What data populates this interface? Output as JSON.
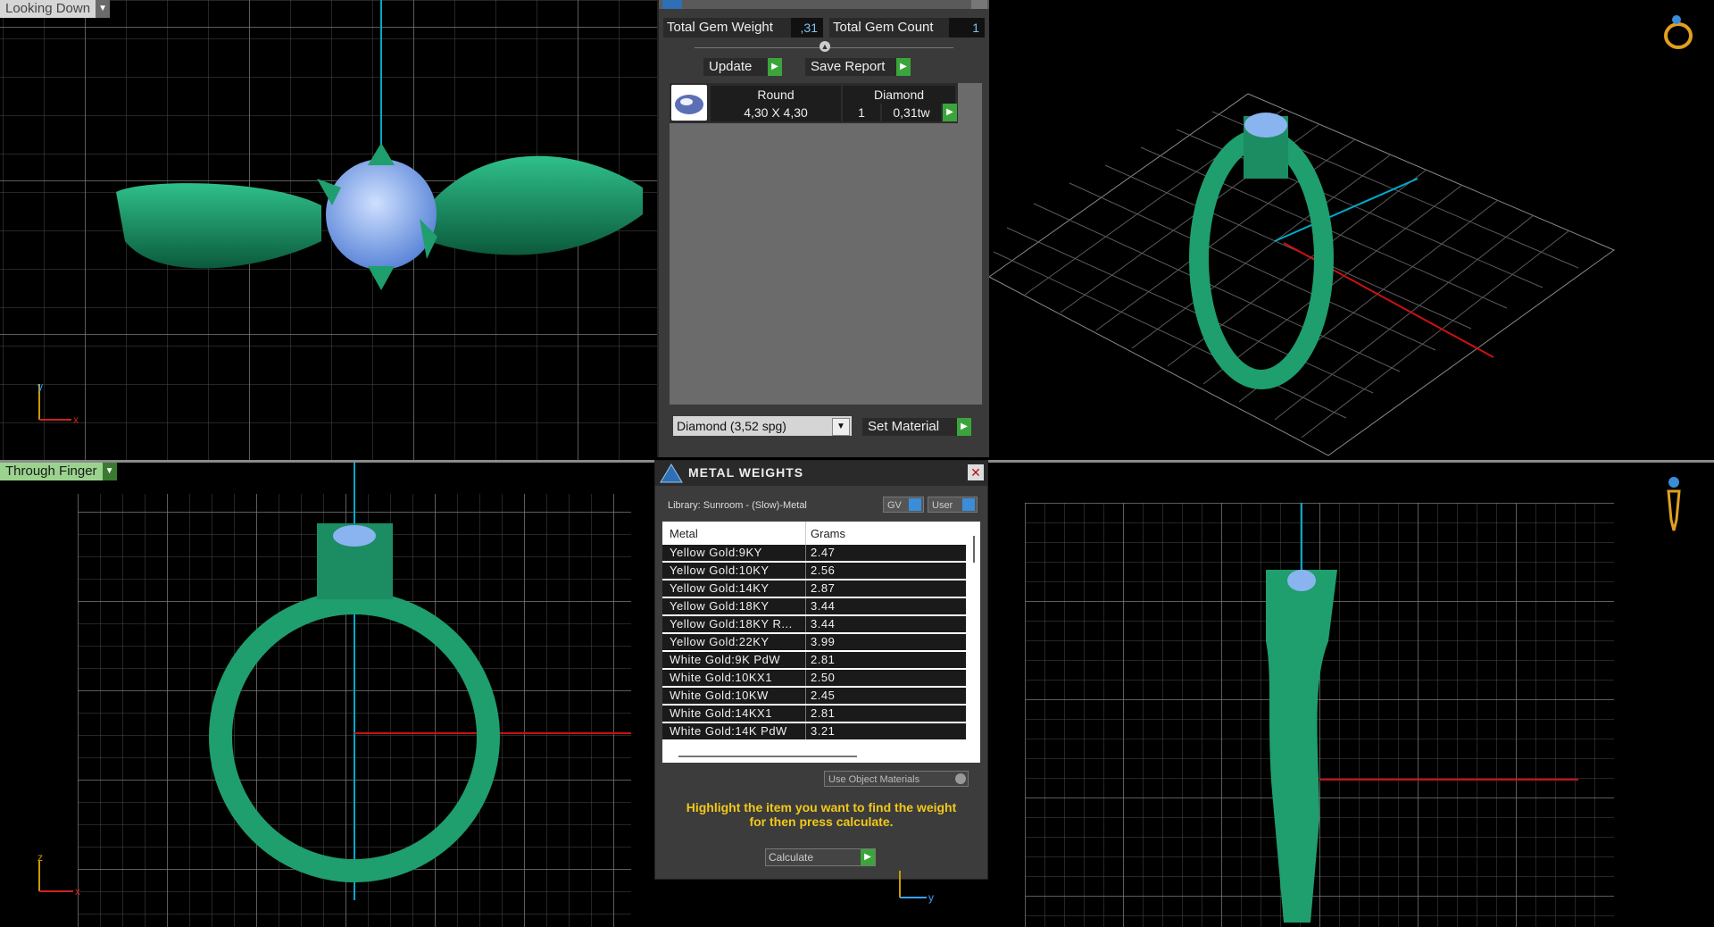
{
  "views": {
    "top_left": {
      "label": "Looking Down"
    },
    "bottom_left": {
      "label": "Through Finger"
    }
  },
  "axes": {
    "tl": {
      "y": "y",
      "x": "x"
    },
    "bl": {
      "z": "z",
      "x": "x"
    },
    "br": {
      "y": "y"
    }
  },
  "gem_panel": {
    "total_weight_label": "Total Gem Weight",
    "total_weight_value": ",31",
    "total_count_label": "Total Gem Count",
    "total_count_value": "1",
    "update_label": "Update",
    "save_report_label": "Save Report",
    "gem_row": {
      "shape": "Round",
      "material": "Diamond",
      "size": "4,30 X 4,30",
      "count": "1",
      "weight": "0,31tw"
    },
    "material_select": "Diamond     (3,52 spg)",
    "set_material_label": "Set Material"
  },
  "metal_weights": {
    "title": "METAL WEIGHTS",
    "library": "Library: Sunroom - (Slow)-Metal",
    "toggle_gv": "GV",
    "toggle_user": "User",
    "col_metal": "Metal",
    "col_grams": "Grams",
    "rows": [
      {
        "metal": "Yellow Gold:9KY",
        "grams": "2.47"
      },
      {
        "metal": "Yellow Gold:10KY",
        "grams": "2.56"
      },
      {
        "metal": "Yellow Gold:14KY",
        "grams": "2.87"
      },
      {
        "metal": "Yellow Gold:18KY",
        "grams": "3.44"
      },
      {
        "metal": "Yellow Gold:18KY R...",
        "grams": "3.44"
      },
      {
        "metal": "Yellow Gold:22KY",
        "grams": "3.99"
      },
      {
        "metal": "White Gold:9K PdW",
        "grams": "2.81"
      },
      {
        "metal": "White Gold:10KX1",
        "grams": "2.50"
      },
      {
        "metal": "White Gold:10KW",
        "grams": "2.45"
      },
      {
        "metal": "White Gold:14KX1",
        "grams": "2.81"
      },
      {
        "metal": "White Gold:14K PdW",
        "grams": "3.21"
      }
    ],
    "use_object_materials": "Use Object Materials",
    "hint_line1": "Highlight the item you want to find the weight",
    "hint_line2": "for then press calculate.",
    "calculate_label": "Calculate"
  },
  "colors": {
    "ring_green": "#1f9e6e",
    "gem_blue": "#8ab4f0",
    "grid": "#5a5a5a",
    "axis_cyan": "#00aacc",
    "axis_red": "#cc1111",
    "accent_yellow": "#f2c81a"
  }
}
